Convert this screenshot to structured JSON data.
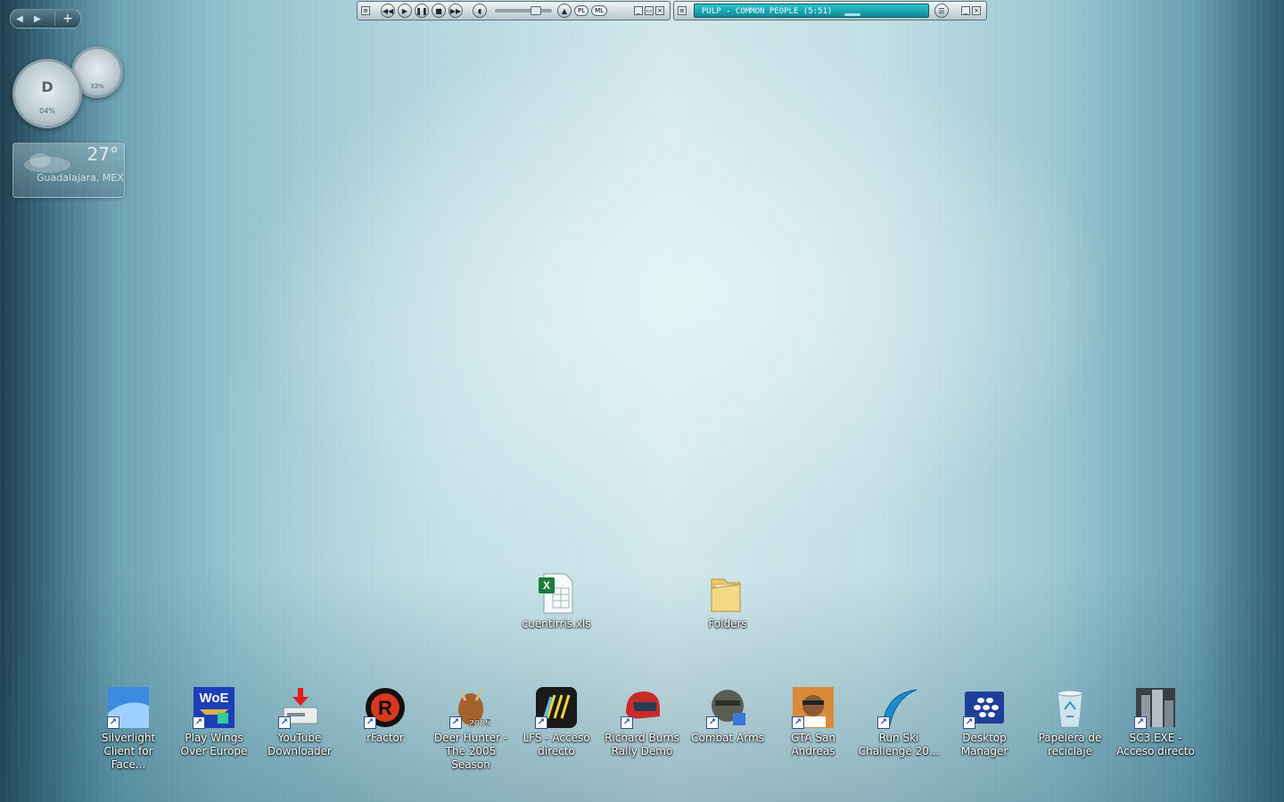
{
  "player": {
    "track": "PULP - COMMON PEOPLE (5:51)",
    "buttons": {
      "pl": "PL",
      "ml": "ML"
    }
  },
  "gadgets": {
    "meter": {
      "big_letter": "D",
      "big_pct": "04%",
      "small_letter": "",
      "small_pct": "33%"
    },
    "weather": {
      "temp": "27°",
      "city": "Guadalajara, MEX"
    }
  },
  "desktop": {
    "files": [
      {
        "label": "cuentirris.xls",
        "icon": "excel-file-icon"
      },
      {
        "label": "Folders",
        "icon": "folder-icon"
      }
    ],
    "shortcuts": [
      {
        "label": "Silverlight Client for Face...",
        "icon": "silverlight-icon"
      },
      {
        "label": "Play Wings Over Europe",
        "icon": "woe-icon",
        "text": "WoE"
      },
      {
        "label": "YouTube Downloader",
        "icon": "youtube-downloader-icon"
      },
      {
        "label": "rFactor",
        "icon": "rfactor-icon",
        "text": "R"
      },
      {
        "label": "Deer Hunter - The 2005 Season",
        "icon": "deer-hunter-icon",
        "text": "2005"
      },
      {
        "label": "LFS - Acceso directo",
        "icon": "lfs-icon"
      },
      {
        "label": "Richard Burns Rally Demo",
        "icon": "helmet-icon"
      },
      {
        "label": "Combat Arms",
        "icon": "combat-arms-icon"
      },
      {
        "label": "GTA San Andreas",
        "icon": "gta-icon"
      },
      {
        "label": "Run Ski Challenge 20...",
        "icon": "ski-icon"
      },
      {
        "label": "Desktop Manager",
        "icon": "blackberry-icon"
      },
      {
        "label": "Papelera de reciclaje",
        "icon": "recycle-bin-icon"
      },
      {
        "label": "SC3.EXE - Acceso directo",
        "icon": "skyscraper-icon"
      }
    ]
  }
}
